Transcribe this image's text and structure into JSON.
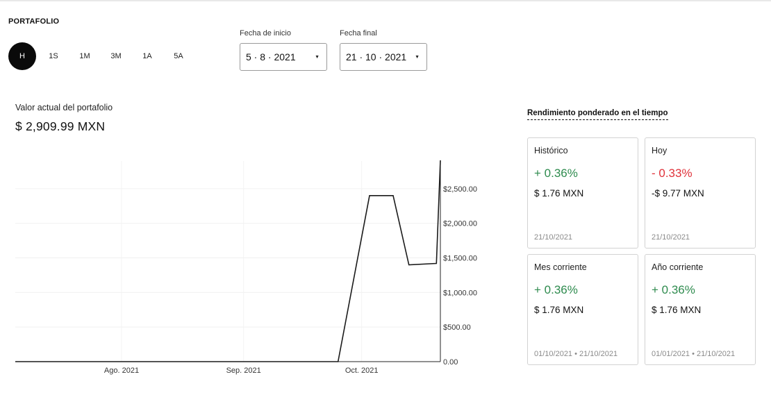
{
  "portfolio": {
    "title": "PORTAFOLIO"
  },
  "ranges": [
    {
      "label": "H",
      "active": true
    },
    {
      "label": "1S",
      "active": false
    },
    {
      "label": "1M",
      "active": false
    },
    {
      "label": "3M",
      "active": false
    },
    {
      "label": "1A",
      "active": false
    },
    {
      "label": "5A",
      "active": false
    }
  ],
  "date_start": {
    "label": "Fecha de inicio",
    "value": "5 · 8 · 2021"
  },
  "date_end": {
    "label": "Fecha final",
    "value": "21 · 10 · 2021"
  },
  "summary": {
    "label": "Valor actual del portafolio",
    "value": "$ 2,909.99 MXN"
  },
  "performance": {
    "title": "Rendimiento ponderado en el tiempo",
    "cards": [
      {
        "label": "Histórico",
        "pct": "+ 0.36%",
        "amount": "$ 1.76 MXN",
        "date": "21/10/2021",
        "trend": "positive"
      },
      {
        "label": "Hoy",
        "pct": "- 0.33%",
        "amount": "-$ 9.77 MXN",
        "date": "21/10/2021",
        "trend": "negative"
      },
      {
        "label": "Mes corriente",
        "pct": "+ 0.36%",
        "amount": "$ 1.76 MXN",
        "date": "01/10/2021 • 21/10/2021",
        "trend": "positive"
      },
      {
        "label": "Año corriente",
        "pct": "+ 0.36%",
        "amount": "$ 1.76 MXN",
        "date": "01/01/2021 • 21/10/2021",
        "trend": "positive"
      }
    ]
  },
  "colors": {
    "positive": "#2e8b4e",
    "negative": "#e0323a",
    "line": "#1a1a1a",
    "active_range": "#0a0a0a"
  },
  "chart_data": {
    "type": "line",
    "x_ticks": [
      "Ago. 2021",
      "Sep. 2021",
      "Oct. 2021"
    ],
    "y_ticks": [
      "$2,500.00",
      "$2,000.00",
      "$1,500.00",
      "$1,000.00",
      "$500.00",
      "0.00"
    ],
    "ylim": [
      0,
      2900
    ],
    "xlim": [
      "2021-07-05",
      "2021-10-21"
    ],
    "grid": true,
    "series": [
      {
        "points": [
          {
            "x": "2021-07-05",
            "y": 0
          },
          {
            "x": "2021-09-25",
            "y": 0
          },
          {
            "x": "2021-10-03",
            "y": 2400
          },
          {
            "x": "2021-10-09",
            "y": 2400
          },
          {
            "x": "2021-10-13",
            "y": 1400
          },
          {
            "x": "2021-10-20",
            "y": 1420
          },
          {
            "x": "2021-10-21",
            "y": 2909.99
          }
        ]
      }
    ]
  }
}
